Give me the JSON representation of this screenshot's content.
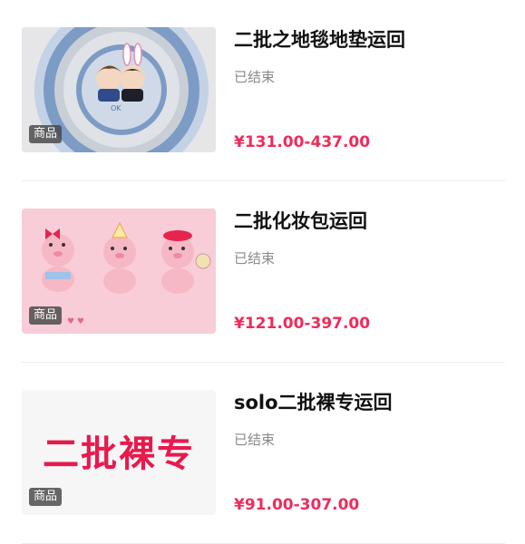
{
  "products": [
    {
      "title": "二批之地毯地垫运回",
      "status": "已结束",
      "price": "¥131.00-437.00",
      "badge": "商品",
      "thumb_icon": "anime-characters-rug-image"
    },
    {
      "title": "二批化妆包运回",
      "status": "已结束",
      "price": "¥121.00-397.00",
      "badge": "商品",
      "thumb_icon": "cute-pig-characters-image"
    },
    {
      "title": "solo二批裸专运回",
      "status": "已结束",
      "price": "¥91.00-307.00",
      "badge": "商品",
      "thumb_text": "二批裸专"
    }
  ],
  "colors": {
    "price": "#ef2b5b",
    "status": "#8a8a8a",
    "title": "#111111",
    "pink_bg": "#f8cdd7",
    "rug_blue": "#7d9dc7"
  }
}
